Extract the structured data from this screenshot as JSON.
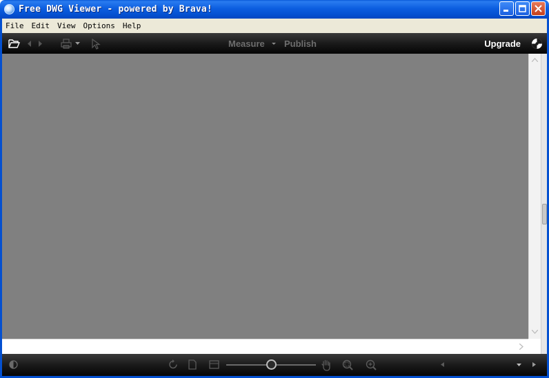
{
  "window": {
    "title": "Free DWG Viewer - powered by Brava!"
  },
  "menu": {
    "items": [
      "File",
      "Edit",
      "View",
      "Options",
      "Help"
    ]
  },
  "toolbar": {
    "measure_label": "Measure",
    "publish_label": "Publish",
    "upgrade_label": "Upgrade",
    "icons": [
      "folder-open-icon",
      "back-arrow-icon",
      "forward-arrow-icon",
      "print-icon",
      "dropdown-arrow-icon",
      "select-pointer-icon",
      "brava-logo-icon"
    ]
  },
  "bottombar": {
    "icons": [
      "contrast-icon",
      "rotate-icon",
      "page-icon",
      "fit-page-icon",
      "zoom-slider",
      "pan-hand-icon",
      "zoom-window-icon",
      "zoom-icon",
      "page-select-dropdown",
      "next-page-icon"
    ],
    "zoom_level": 0.5
  },
  "colors": {
    "titlebar": "#0c5ee0",
    "canvas": "#808080",
    "toolbar": "#1a1a1a",
    "menubar": "#ece9d8"
  }
}
